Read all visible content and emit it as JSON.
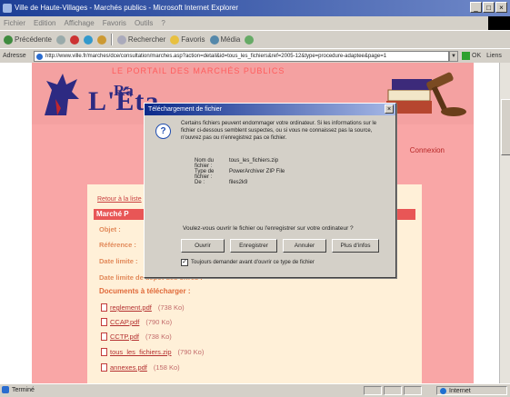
{
  "window": {
    "title": "Ville de Haute-Villages - Marchés publics - Microsoft Internet Explorer"
  },
  "menu": [
    "Fichier",
    "Edition",
    "Affichage",
    "Favoris",
    "Outils",
    "?"
  ],
  "toolbar": {
    "back": "Précédente",
    "search": "Rechercher",
    "favorites": "Favoris",
    "media": "Média"
  },
  "address": {
    "label": "Adresse",
    "url": "http://www.ville.fr/marches/dce/consultation/marches.asp?action=detail&id=tous_les_fichiers&ref=2005-12&type=procedure-adaptee&page=1",
    "go": "OK",
    "links": "Liens"
  },
  "page": {
    "banner_top": "LE PORTAIL DES MARCHÉS PUBLICS",
    "brand_prefix": "L'Éta",
    "brand_sub": "Ra",
    "connexion": "Connexion",
    "breadcrumb": "Retour à la liste",
    "section": "Marché P",
    "info": [
      "Objet :",
      "Référence :",
      "Date limite :",
      "Date limite de dépôt des offres :"
    ],
    "docs_title": "Documents à télécharger :",
    "docs": [
      {
        "name": "reglement.pdf",
        "size": "(738 Ko)"
      },
      {
        "name": "CCAP.pdf",
        "size": "(790 Ko)"
      },
      {
        "name": "CCTP.pdf",
        "size": "(738 Ko)"
      },
      {
        "name": "tous_les_fichiers.zip",
        "size": "(790 Ko)"
      },
      {
        "name": "annexes.pdf",
        "size": "(158 Ko)"
      }
    ]
  },
  "dialog": {
    "title": "Téléchargement de fichier",
    "warning": "Certains fichiers peuvent endommager votre ordinateur. Si les informations sur le fichier ci-dessous semblent suspectes, ou si vous ne connaissez pas la source, n'ouvrez pas ou n'enregistrez pas ce fichier.",
    "fields": [
      {
        "label": "Nom du fichier :",
        "value": "tous_les_fichiers.zip"
      },
      {
        "label": "Type de fichier :",
        "value": "PowerArchiver ZIP File"
      },
      {
        "label": "De :",
        "value": "files2k9"
      }
    ],
    "question": "Voulez-vous ouvrir le fichier ou l'enregistrer sur votre ordinateur ?",
    "buttons": {
      "open": "Ouvrir",
      "save": "Enregistrer",
      "cancel": "Annuler",
      "more": "Plus d'infos"
    },
    "checkbox": "Toujours demander avant d'ouvrir ce type de fichier",
    "checkbox_checked": true
  },
  "status": {
    "left": "Terminé",
    "zone": "Internet"
  }
}
